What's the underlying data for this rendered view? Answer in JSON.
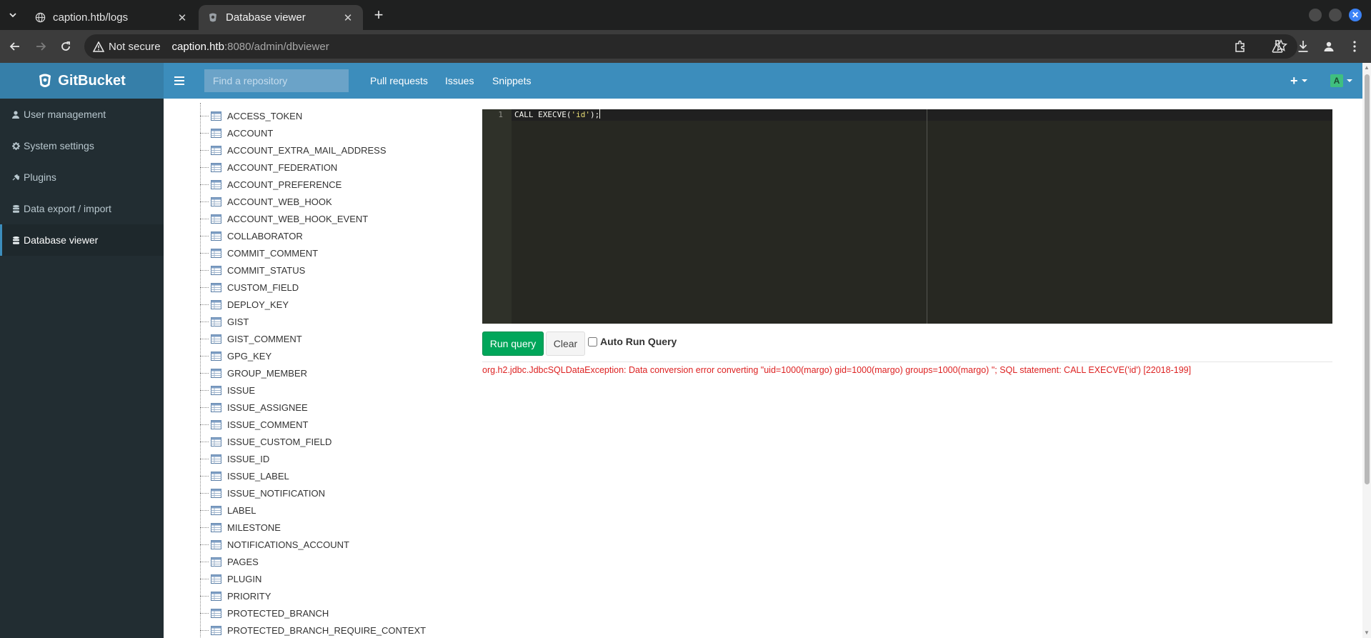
{
  "browser": {
    "tabs": [
      {
        "title": "caption.htb/logs",
        "active": false
      },
      {
        "title": "Database viewer",
        "active": true
      }
    ],
    "security_label": "Not secure",
    "url_host": "caption.htb",
    "url_rest": ":8080/admin/dbviewer"
  },
  "header": {
    "brand": "GitBucket",
    "search_placeholder": "Find a repository",
    "links": [
      "Pull requests",
      "Issues",
      "Snippets"
    ],
    "avatar_letter": "A"
  },
  "sidebar": {
    "items": [
      {
        "label": "User management",
        "icon": "user-icon"
      },
      {
        "label": "System settings",
        "icon": "gear-icon"
      },
      {
        "label": "Plugins",
        "icon": "plug-icon"
      },
      {
        "label": "Data export / import",
        "icon": "database-icon"
      },
      {
        "label": "Database viewer",
        "icon": "database-icon",
        "active": true
      }
    ]
  },
  "tables": [
    "ACCESS_TOKEN",
    "ACCOUNT",
    "ACCOUNT_EXTRA_MAIL_ADDRESS",
    "ACCOUNT_FEDERATION",
    "ACCOUNT_PREFERENCE",
    "ACCOUNT_WEB_HOOK",
    "ACCOUNT_WEB_HOOK_EVENT",
    "COLLABORATOR",
    "COMMIT_COMMENT",
    "COMMIT_STATUS",
    "CUSTOM_FIELD",
    "DEPLOY_KEY",
    "GIST",
    "GIST_COMMENT",
    "GPG_KEY",
    "GROUP_MEMBER",
    "ISSUE",
    "ISSUE_ASSIGNEE",
    "ISSUE_COMMENT",
    "ISSUE_CUSTOM_FIELD",
    "ISSUE_ID",
    "ISSUE_LABEL",
    "ISSUE_NOTIFICATION",
    "LABEL",
    "MILESTONE",
    "NOTIFICATIONS_ACCOUNT",
    "PAGES",
    "PLUGIN",
    "PRIORITY",
    "PROTECTED_BRANCH",
    "PROTECTED_BRANCH_REQUIRE_CONTEXT"
  ],
  "editor": {
    "line_number": "1",
    "code_prefix": "CALL EXECVE(",
    "code_string": "'id'",
    "code_suffix": ");"
  },
  "actions": {
    "run_label": "Run query",
    "clear_label": "Clear",
    "auto_run_label": "Auto Run Query"
  },
  "result": {
    "error": "org.h2.jdbc.JdbcSQLDataException: Data conversion error converting \"uid=1000(margo) gid=1000(margo) groups=1000(margo) \"; SQL statement: CALL EXECVE('id') [22018-199]"
  },
  "colors": {
    "brand_bar": "#367fa9",
    "nav_bar": "#3c8dbc",
    "sidebar": "#222d32",
    "run_button": "#00a65a",
    "error_text": "#dd2222",
    "editor_bg": "#272822"
  }
}
